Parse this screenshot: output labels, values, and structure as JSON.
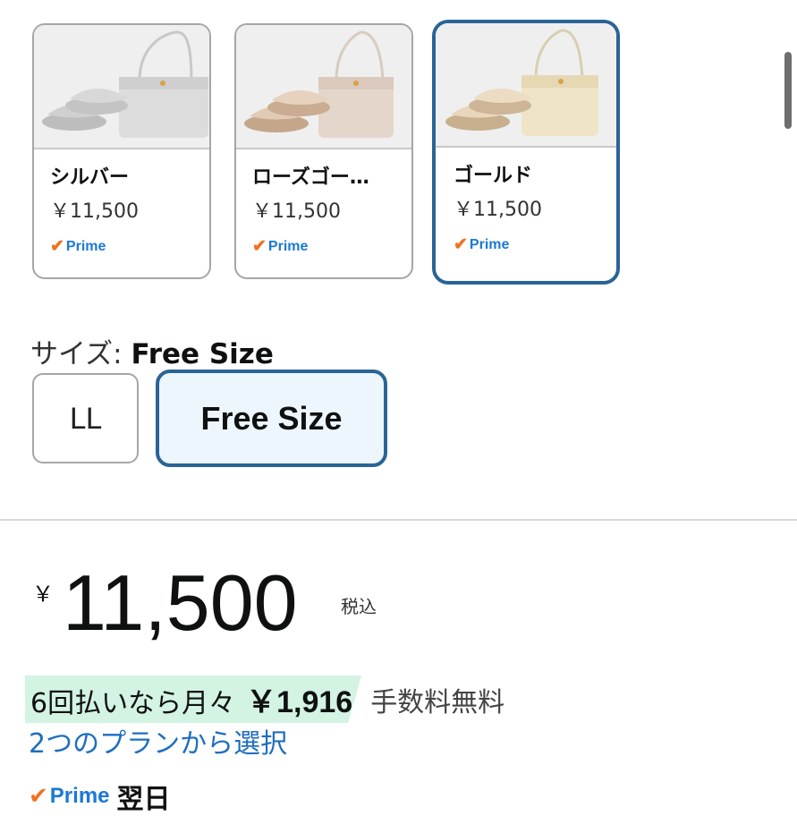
{
  "colors": [
    {
      "name": "シルバー",
      "price": "￥11,500",
      "prime": "Prime",
      "selected": false
    },
    {
      "name": "ローズゴー…",
      "price": "￥11,500",
      "prime": "Prime",
      "selected": false
    },
    {
      "name": "ゴールド",
      "price": "￥11,500",
      "prime": "Prime",
      "selected": true
    }
  ],
  "size": {
    "label": "サイズ:",
    "selected_value": "Free Size",
    "options": [
      "LL",
      "Free Size"
    ]
  },
  "price": {
    "currency": "￥",
    "amount": "11,500",
    "tax_note": "税込"
  },
  "installment": {
    "text": "6回払いなら月々",
    "amount": "￥1,916",
    "fee_text": "手数料無料",
    "plan_link": "2つのプランから選択"
  },
  "delivery": {
    "prime": "Prime",
    "text": "翌日"
  },
  "accent": {
    "selected_border": "#2a6496",
    "prime_blue": "#1a79d6",
    "check_orange": "#f0721f",
    "installment_bg": "#d3f3e3",
    "link_blue": "#1f6ebf"
  }
}
